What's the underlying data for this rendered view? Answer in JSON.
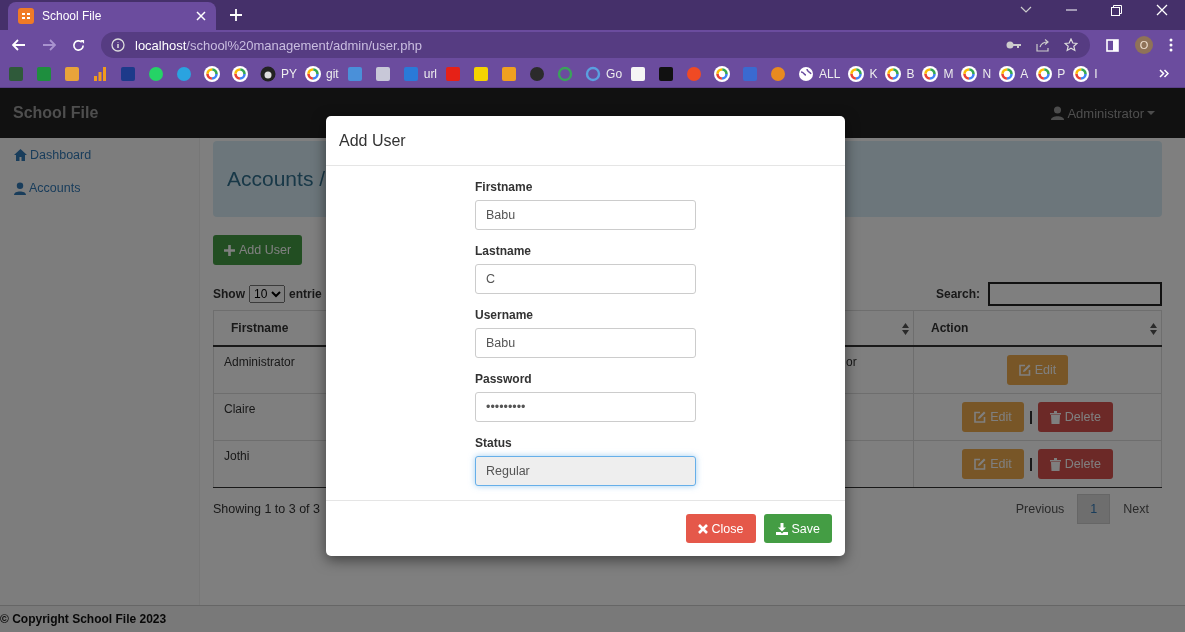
{
  "browser": {
    "tab": {
      "title": "School File"
    },
    "url_host": "localhost",
    "url_path": "/school%20management/admin/user.php",
    "profile_initial": "O",
    "bookmarks": [
      {
        "kind": "square",
        "color": "#2f5a3a"
      },
      {
        "kind": "square",
        "color": "#1e8e3e"
      },
      {
        "kind": "square",
        "color": "#e8a33a"
      },
      {
        "kind": "bars",
        "color": "#f29b1d"
      },
      {
        "kind": "square",
        "color": "#1d3a8a"
      },
      {
        "kind": "circle",
        "color": "#25d366"
      },
      {
        "kind": "circle",
        "color": "#2aa3e0"
      },
      {
        "kind": "google"
      },
      {
        "kind": "google"
      },
      {
        "kind": "github",
        "label": "PY"
      },
      {
        "kind": "google",
        "label": "git"
      },
      {
        "kind": "square",
        "color": "#4a90d9"
      },
      {
        "kind": "square",
        "color": "#c8c8d8"
      },
      {
        "kind": "square",
        "color": "#2a7ad8",
        "label": "url"
      },
      {
        "kind": "square",
        "color": "#e62117"
      },
      {
        "kind": "square",
        "color": "#f5d300"
      },
      {
        "kind": "square",
        "color": "#f0a020"
      },
      {
        "kind": "circle",
        "color": "#2b2b2b"
      },
      {
        "kind": "ring",
        "color": "#3aa35a"
      },
      {
        "kind": "ring",
        "color": "#5aa0e0",
        "label": "Go"
      },
      {
        "kind": "square",
        "color": "#f5f5f5"
      },
      {
        "kind": "square",
        "color": "#111111"
      },
      {
        "kind": "circle",
        "color": "#f04a24"
      },
      {
        "kind": "google"
      },
      {
        "kind": "square",
        "color": "#3a6ad0"
      },
      {
        "kind": "circle",
        "color": "#e88a20"
      },
      {
        "kind": "globe",
        "label": "ALL"
      },
      {
        "kind": "google",
        "label": "K"
      },
      {
        "kind": "google",
        "label": "B"
      },
      {
        "kind": "google",
        "label": "M"
      },
      {
        "kind": "google",
        "label": "N"
      },
      {
        "kind": "google",
        "label": "A"
      },
      {
        "kind": "google",
        "label": "P"
      },
      {
        "kind": "google",
        "label": "I"
      }
    ]
  },
  "navbar": {
    "brand": "School File",
    "user": "Administrator"
  },
  "sidebar": {
    "items": [
      {
        "label": "Dashboard",
        "kind": "home"
      },
      {
        "label": "Accounts",
        "kind": "user"
      }
    ]
  },
  "heading": "Accounts /",
  "add_button": "Add User",
  "length": {
    "label": "Show",
    "value": "10",
    "suffix": "entrie"
  },
  "search": {
    "label": "Search:"
  },
  "table": {
    "columns": [
      "Firstname",
      "Action"
    ],
    "rows": [
      {
        "firstname": "Administrator",
        "column_3": "or",
        "actions": [
          {
            "kind": "edit",
            "label": "Edit"
          }
        ]
      },
      {
        "firstname": "Claire",
        "actions": [
          {
            "kind": "edit",
            "label": "Edit"
          },
          {
            "kind": "delete",
            "label": "Delete"
          }
        ]
      },
      {
        "firstname": "Jothi",
        "actions": [
          {
            "kind": "edit",
            "label": "Edit"
          },
          {
            "kind": "delete",
            "label": "Delete"
          }
        ]
      }
    ]
  },
  "info": "Showing 1 to 3 of 3",
  "pagination": {
    "previous": {
      "label": "Previous",
      "disabled": true
    },
    "pages": [
      {
        "label": "1",
        "selected": true
      }
    ],
    "next": {
      "label": "Next",
      "disabled": true
    }
  },
  "footer": "© Copyright School File 2023",
  "modal": {
    "title": "Add User",
    "fields": [
      {
        "label": "Firstname",
        "value": "Babu",
        "focused": false
      },
      {
        "label": "Lastname",
        "value": "C",
        "focused": false
      },
      {
        "label": "Username",
        "value": "Babu",
        "focused": false
      },
      {
        "label": "Password",
        "value": "•••••••••",
        "focused": false
      },
      {
        "label": "Status",
        "value": "Regular",
        "focused": true
      }
    ],
    "buttons": [
      {
        "kind": "close",
        "label": "Close"
      },
      {
        "kind": "save",
        "label": "Save"
      }
    ]
  }
}
